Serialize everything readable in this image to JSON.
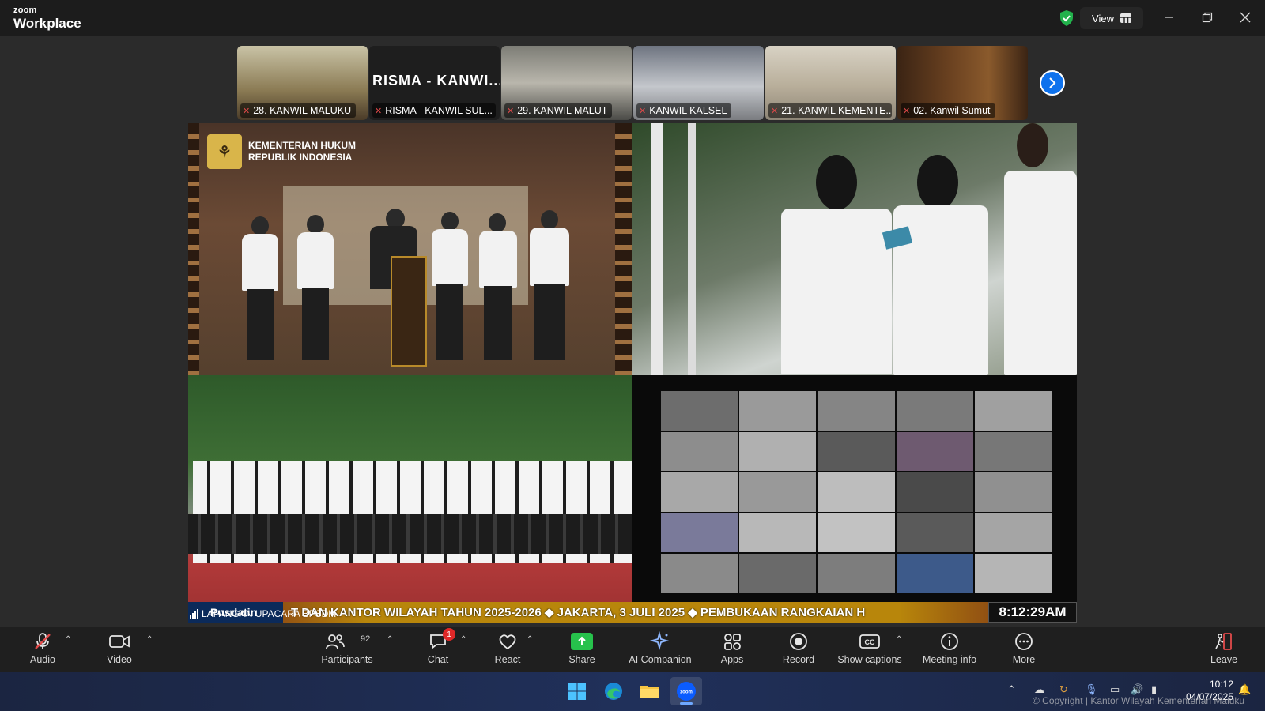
{
  "app": {
    "brand_small": "zoom",
    "brand_big": "Workplace",
    "view_label": "View"
  },
  "colors": {
    "accent": "#0e72ed",
    "share_green": "#27c24c",
    "mic_off": "#e24a4a",
    "badge_red": "#e02828"
  },
  "thumbnails": [
    {
      "label": "28. KANWIL MALUKU"
    },
    {
      "label": "RISMA - KANWIL SUL...",
      "big_text": "RISMA - KANWI..."
    },
    {
      "label": "29. KANWIL MALUT"
    },
    {
      "label": "KANWIL KALSEL"
    },
    {
      "label": "21. KANWIL KEMENTE..."
    },
    {
      "label": "02. Kanwil Sumut"
    }
  ],
  "share": {
    "ministry_line1": "KEMENTERIAN HUKUM",
    "ministry_line2": "REPUBLIK INDONESIA",
    "ticker_left": "Pusdatin",
    "ticker_text": "T DAN KANTOR WILAYAH TAHUN 2025-2026  ◆  JAKARTA, 3 JULI 2025  ◆  PEMBUKAAN RANGKAIAN H",
    "ticker_clock": "8:12:29AM",
    "location": "LAPANGAN UPACARA BPSDM"
  },
  "toolbar": {
    "audio": "Audio",
    "video": "Video",
    "participants": "Participants",
    "participants_count": "92",
    "chat": "Chat",
    "chat_badge": "1",
    "react": "React",
    "share": "Share",
    "ai_companion": "AI Companion",
    "apps": "Apps",
    "record": "Record",
    "captions": "Show captions",
    "meeting_info": "Meeting info",
    "more": "More",
    "leave": "Leave"
  },
  "taskbar": {
    "time": "10:12",
    "date": "04/07/2025"
  },
  "watermark": "© Copyright | Kantor Wilayah Kementerian Maluku"
}
